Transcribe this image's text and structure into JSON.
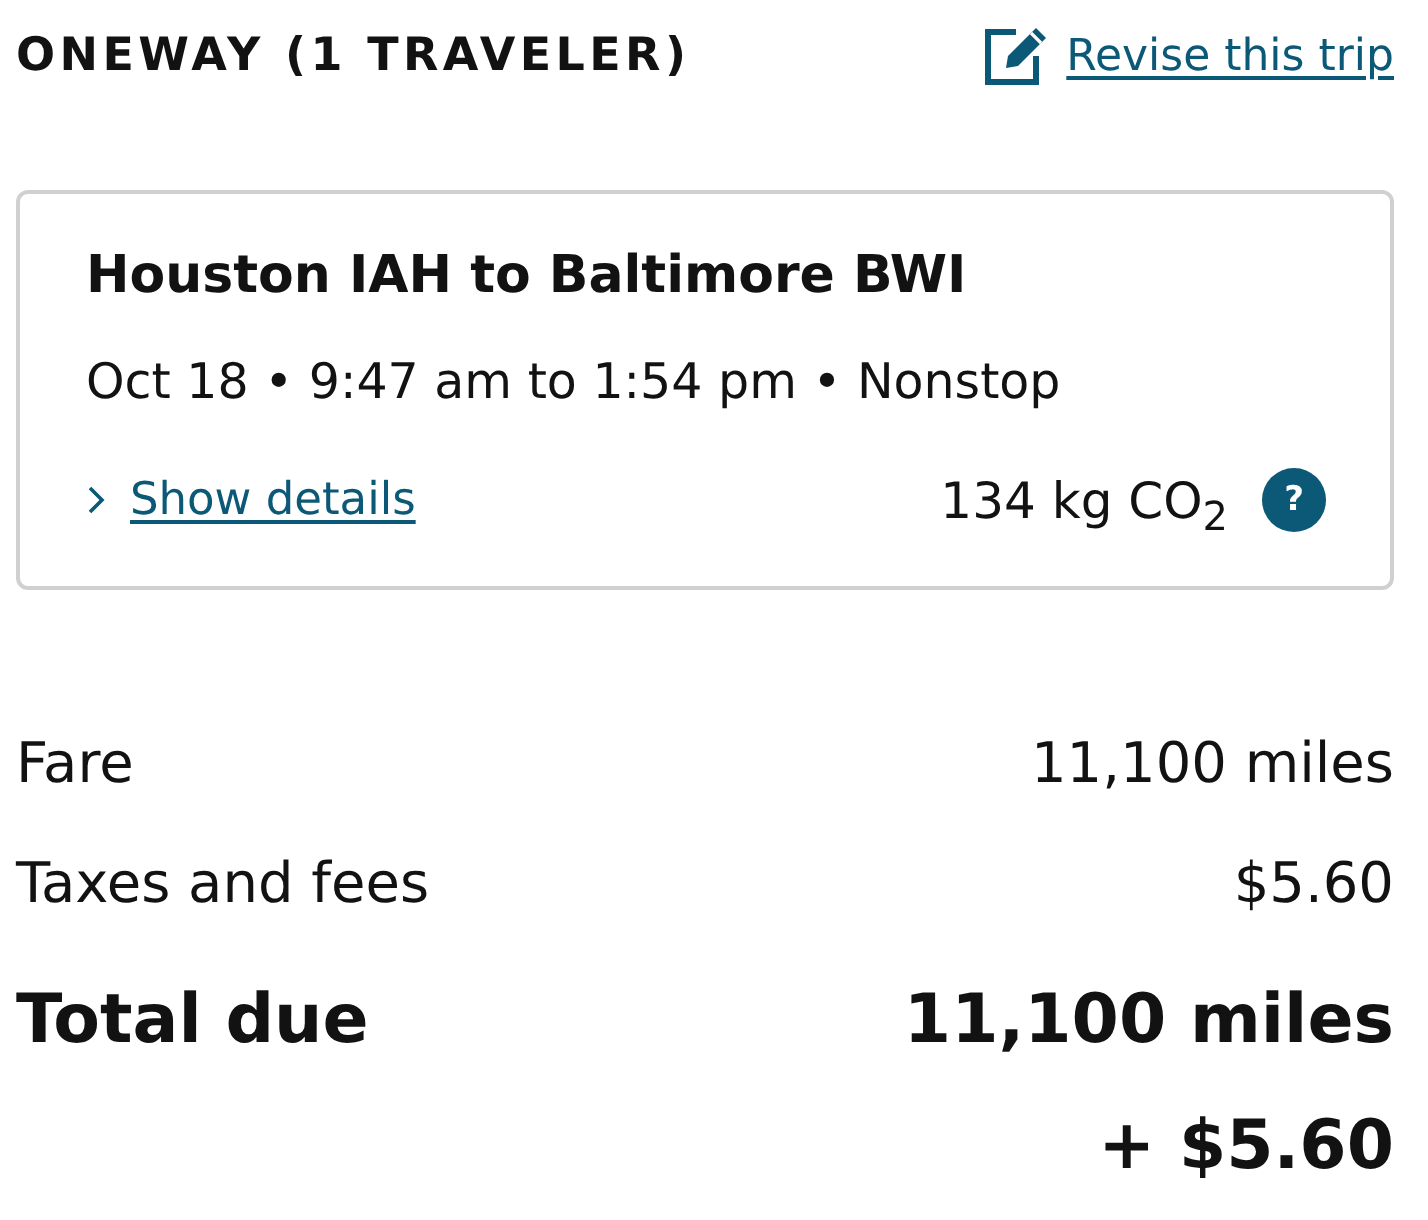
{
  "header": {
    "title": "ONEWAY (1 TRAVELER)",
    "revise_link": "Revise this trip"
  },
  "trip": {
    "route": "Houston IAH to Baltimore BWI",
    "schedule": "Oct 18 • 9:47 am to 1:54 pm • Nonstop",
    "details_link": "Show details",
    "expanded": false,
    "emissions": "134 kg CO$_{2}$",
    "help": "?"
  },
  "price_lines": [
    {
      "kind": "line",
      "label": "Fare",
      "value": "11,100 miles"
    },
    {
      "kind": "line",
      "label": "Taxes and fees",
      "value": "$5.60"
    },
    {
      "kind": "total",
      "label": "Total due",
      "value": "11,100 miles",
      "extra": "+ $5.60"
    }
  ]
}
